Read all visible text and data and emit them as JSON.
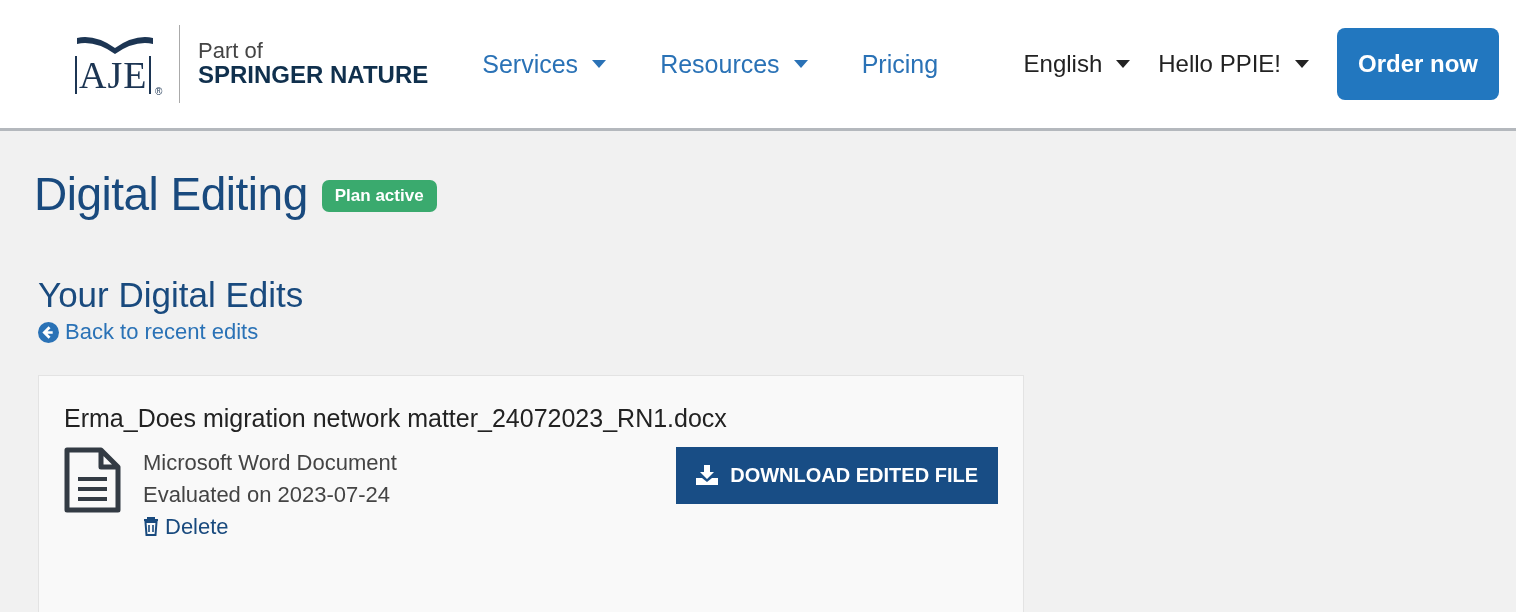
{
  "logo": {
    "mark": "AJE",
    "registered": "®",
    "part_of": "Part of",
    "brand": "SPRINGER NATURE"
  },
  "nav": [
    {
      "label": "Services",
      "has_menu": true
    },
    {
      "label": "Resources",
      "has_menu": true
    },
    {
      "label": "Pricing",
      "has_menu": false
    }
  ],
  "account": [
    {
      "label": "English",
      "has_menu": true
    },
    {
      "label": "Hello PPIE!",
      "has_menu": true
    }
  ],
  "order_button": "Order now",
  "page_title": "Digital Editing",
  "plan_badge": "Plan active",
  "section_title": "Your Digital Edits",
  "back_link": "Back to recent edits",
  "file": {
    "name": "Erma_Does migration network matter_24072023_RN1.docx",
    "type": "Microsoft Word Document",
    "evaluated": "Evaluated on 2023-07-24",
    "delete": "Delete",
    "download": "DOWNLOAD EDITED FILE"
  }
}
